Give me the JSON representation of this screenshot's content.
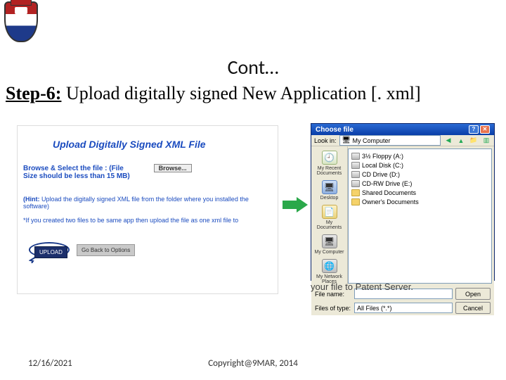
{
  "header": {
    "title": "Cont…"
  },
  "step": {
    "label": "Step-6:",
    "text": " Upload digitally signed New Application [. xml]"
  },
  "leftPanel": {
    "heading": "Upload Digitally Signed XML File",
    "browseLabel1": "Browse & Select the file : (File",
    "browseLabel2": "Size should be less than 15 MB)",
    "browseBtn": "Browse...",
    "hintLabel": "(Hint:",
    "hintText": " Upload the digitally signed XML file from the folder where you installed the software)",
    "note": "*If you created two files to be same app then upload the file as one xml file to",
    "uploadBtn": "UPLOAD",
    "backBtn": "Go Back to Options"
  },
  "dialog": {
    "title": "Choose file",
    "lookInLabel": "Look in:",
    "lookInValue": "My Computer",
    "places": {
      "recent": "My Recent Documents",
      "desktop": "Desktop",
      "mydocs": "My Documents",
      "mycomputer": "My Computer",
      "network": "My Network Places"
    },
    "items": {
      "i0": "3½ Floppy (A:)",
      "i1": "Local Disk (C:)",
      "i2": "CD Drive (D:)",
      "i3": "CD-RW Drive (E:)",
      "i4": "Shared Documents",
      "i5": "Owner's Documents"
    },
    "fileNameLabel": "File name:",
    "fileTypeLabel": "Files of type:",
    "fileTypeValue": "All Files (*.*)",
    "openBtn": "Open",
    "cancelBtn": "Cancel"
  },
  "underDialog": "your file to Patent Server.",
  "footer": {
    "date": "12/16/2021",
    "copyright": "Copyright@9MAR, 2014"
  }
}
